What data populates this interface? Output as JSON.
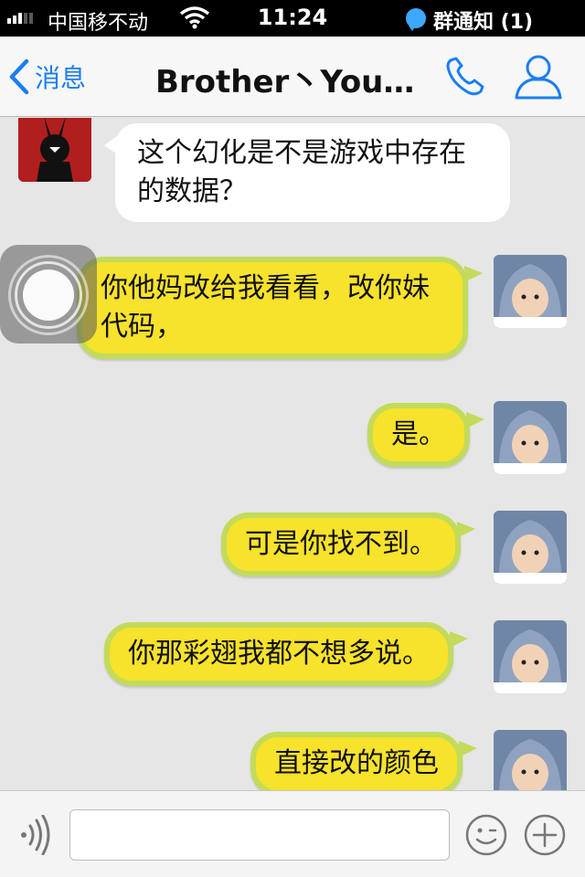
{
  "status_bar": {
    "carrier": "中国移不动",
    "time": "11:24",
    "notification": "群通知 (1)"
  },
  "nav": {
    "back_label": "消息",
    "title": "Brother丶Youn…"
  },
  "messages": [
    {
      "side": "left",
      "text": "这个幻化是不是游戏中存在的数据？"
    },
    {
      "side": "right",
      "text": "你他妈改给我看看，改你妹代码，"
    },
    {
      "side": "right",
      "text": "是。"
    },
    {
      "side": "right",
      "text": "可是你找不到。"
    },
    {
      "side": "right",
      "text": "你那彩翅我都不想多说。"
    },
    {
      "side": "right",
      "text": "直接改的颜色"
    }
  ],
  "input": {
    "placeholder": ""
  },
  "icons": {
    "back": "chevron-left-icon",
    "phone": "phone-icon",
    "profile": "person-icon",
    "voice": "voice-icon",
    "emoji": "emoji-icon",
    "plus": "plus-icon"
  },
  "colors": {
    "accent": "#1b7ef2",
    "bubble_right": "#f7e22c",
    "bubble_right_border": "#c2db5a",
    "bubble_left": "#ffffff",
    "chat_background": "#e6e6e6"
  }
}
